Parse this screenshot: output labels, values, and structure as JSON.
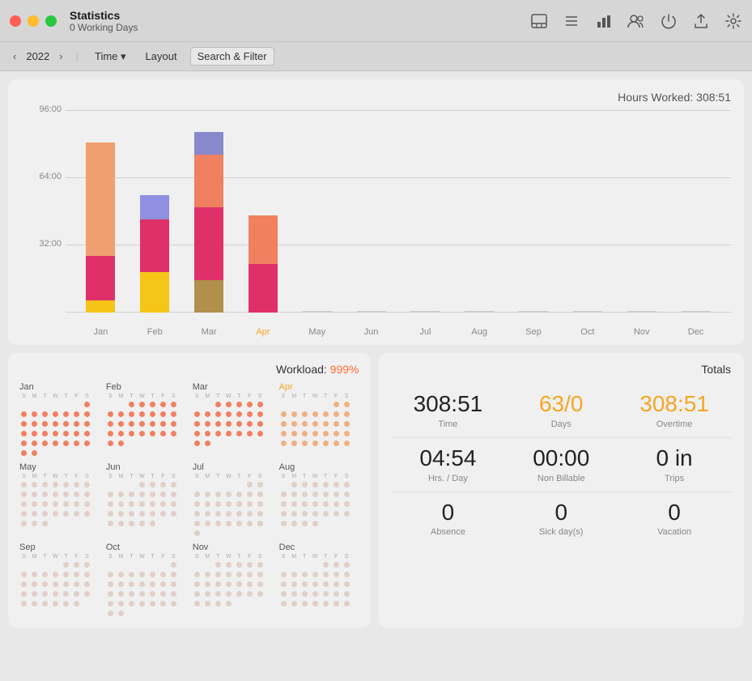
{
  "titlebar": {
    "title": "Statistics",
    "subtitle": "0 Working Days"
  },
  "navbar": {
    "year": "2022",
    "time_label": "Time",
    "layout_label": "Layout",
    "filter_label": "Search & Filter"
  },
  "chart": {
    "title": "Hours Worked: 308:51",
    "y_labels": [
      "96:00",
      "64:00",
      "32:00"
    ],
    "x_labels": [
      "Jan",
      "Feb",
      "Mar",
      "Apr",
      "May",
      "Jun",
      "Jul",
      "Aug",
      "Sep",
      "Oct",
      "Nov",
      "Dec"
    ],
    "active_month": "Apr",
    "bars": [
      {
        "month": "Jan",
        "segments": [
          {
            "color": "#f0a070",
            "height": 140
          },
          {
            "color": "#e0306a",
            "height": 55
          },
          {
            "color": "#f5c518",
            "height": 15
          }
        ]
      },
      {
        "month": "Feb",
        "segments": [
          {
            "color": "#9090e0",
            "height": 30
          },
          {
            "color": "#e0306a",
            "height": 65
          },
          {
            "color": "#f5c518",
            "height": 50
          }
        ]
      },
      {
        "month": "Mar",
        "segments": [
          {
            "color": "#8888cc",
            "height": 28
          },
          {
            "color": "#e0306a",
            "height": 90
          },
          {
            "color": "#b0904a",
            "height": 40
          },
          {
            "color": "#f08060",
            "height": 65
          }
        ]
      },
      {
        "month": "Apr",
        "segments": [
          {
            "color": "#e0306a",
            "height": 60
          },
          {
            "color": "#f08060",
            "height": 60
          }
        ]
      },
      {
        "month": "May",
        "segments": []
      },
      {
        "month": "Jun",
        "segments": []
      },
      {
        "month": "Jul",
        "segments": []
      },
      {
        "month": "Aug",
        "segments": []
      },
      {
        "month": "Sep",
        "segments": []
      },
      {
        "month": "Oct",
        "segments": []
      },
      {
        "month": "Nov",
        "segments": []
      },
      {
        "month": "Dec",
        "segments": []
      }
    ]
  },
  "workload": {
    "title": "Workload:",
    "value": "999%",
    "months": [
      "Jan",
      "Feb",
      "Mar",
      "Apr",
      "May",
      "Jun",
      "Jul",
      "Aug",
      "Sep",
      "Oct",
      "Nov",
      "Dec"
    ],
    "active_month": "Apr",
    "dow_labels": [
      "S",
      "M",
      "T",
      "W",
      "T",
      "F",
      "S"
    ]
  },
  "totals": {
    "title": "Totals",
    "cells": [
      {
        "value": "308:51",
        "label": "Time",
        "style": "normal"
      },
      {
        "value": "63/0",
        "label": "Days",
        "style": "orange"
      },
      {
        "value": "308:51",
        "label": "Overtime",
        "style": "orange"
      },
      {
        "value": "04:54",
        "label": "Hrs. / Day",
        "style": "normal"
      },
      {
        "value": "00:00",
        "label": "Non Billable",
        "style": "normal"
      },
      {
        "value": "0 in",
        "label": "Trips",
        "style": "normal"
      },
      {
        "value": "0",
        "label": "Absence",
        "style": "normal"
      },
      {
        "value": "0",
        "label": "Sick day(s)",
        "style": "normal"
      },
      {
        "value": "0",
        "label": "Vacation",
        "style": "normal"
      }
    ]
  }
}
